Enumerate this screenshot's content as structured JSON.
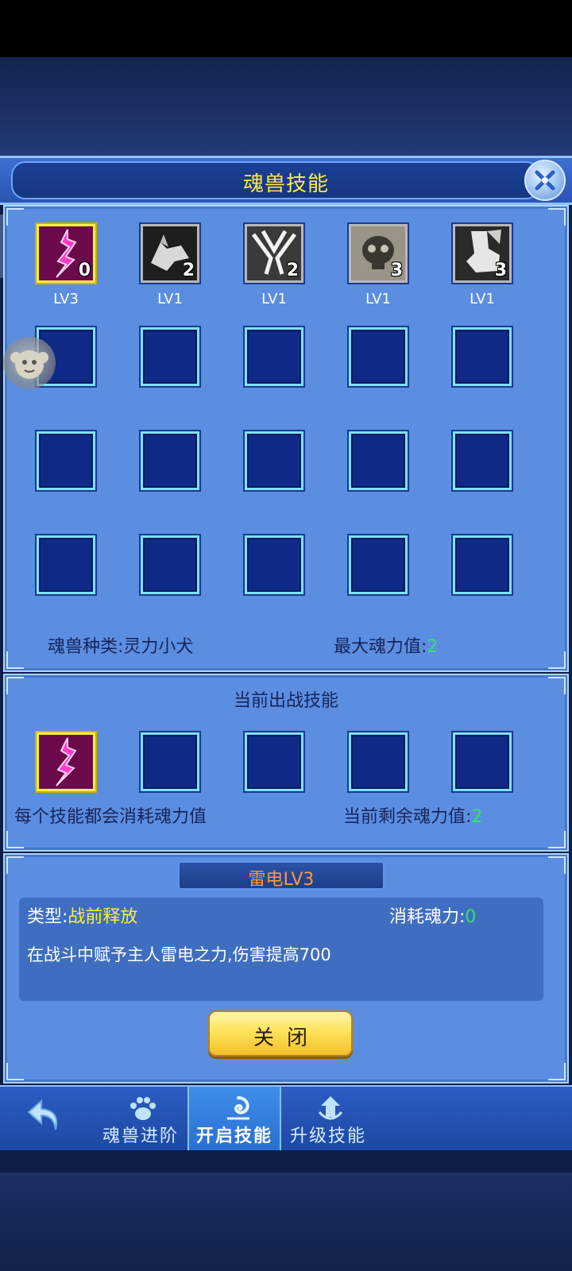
{
  "title": "魂兽技能",
  "skills": [
    {
      "level": "LV3",
      "count": "0",
      "icon": "lightning-icon",
      "selected": true
    },
    {
      "level": "LV1",
      "count": "2",
      "icon": "wolf-head-icon",
      "selected": false
    },
    {
      "level": "LV1",
      "count": "2",
      "icon": "claws-icon",
      "selected": false
    },
    {
      "level": "LV1",
      "count": "3",
      "icon": "skull-icon",
      "selected": false
    },
    {
      "level": "LV1",
      "count": "3",
      "icon": "beast-leg-icon",
      "selected": false
    }
  ],
  "species_label": "魂兽种类:",
  "species_value": "灵力小犬",
  "max_power_label": "最大魂力值:",
  "max_power_value": "2",
  "battle_title": "当前出战技能",
  "battle_note": "每个技能都会消耗魂力值",
  "remaining_label": "当前剩余魂力值:",
  "remaining_value": "2",
  "detail": {
    "name": "雷电LV3",
    "type_label": "类型:",
    "type_value": "战前释放",
    "cost_label": "消耗魂力:",
    "cost_value": "0",
    "description": "在战斗中赋予主人雷电之力,伤害提高700"
  },
  "close_button": "关闭",
  "nav": {
    "tabs": [
      {
        "label": "魂兽进阶",
        "icon": "paw-icon"
      },
      {
        "label": "开启技能",
        "icon": "swirl-icon"
      },
      {
        "label": "升级技能",
        "icon": "upgrade-icon"
      }
    ],
    "active_tab": "开启技能"
  },
  "colors": {
    "panel": "#5b8ee0",
    "slot": "#0f2a86",
    "slot_border": "#7fe0ff",
    "accent_yellow": "#ffec3b",
    "accent_green": "#2fe66a",
    "skill_name": "#ff9a2e"
  }
}
